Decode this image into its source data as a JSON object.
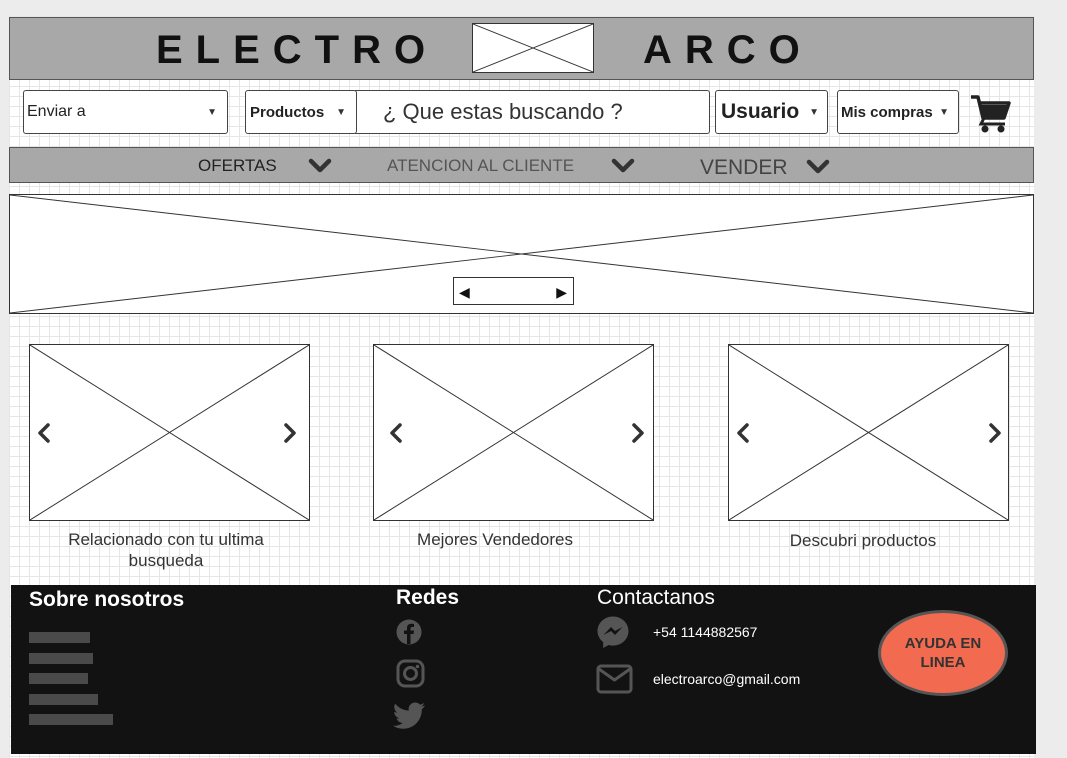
{
  "header": {
    "logo_left": "ELECTRO",
    "logo_right": "ARCO"
  },
  "search_row": {
    "ship_to": "Enviar a",
    "category": "Productos",
    "search_placeholder": "¿ Que estas buscando ?",
    "user": "Usuario",
    "purchases": "Mis compras",
    "cart_icon": "shopping-cart-icon"
  },
  "nav": {
    "items": [
      {
        "label": "OFERTAS"
      },
      {
        "label": "ATENCION AL CLIENTE"
      },
      {
        "label": "VENDER"
      }
    ]
  },
  "cards": [
    {
      "label": "Relacionado con tu ultima busqueda"
    },
    {
      "label": "Mejores Vendedores"
    },
    {
      "label": "Descubri productos"
    }
  ],
  "footer": {
    "about_title": "Sobre nosotros",
    "social_title": "Redes",
    "social_icons": [
      "facebook-icon",
      "instagram-icon",
      "twitter-icon"
    ],
    "contact_title": "Contactanos",
    "phone": "+54 1144882567",
    "email": "electroarco@gmail.com",
    "help_button": "AYUDA EN LINEA",
    "help_color": "#f26a4f"
  }
}
